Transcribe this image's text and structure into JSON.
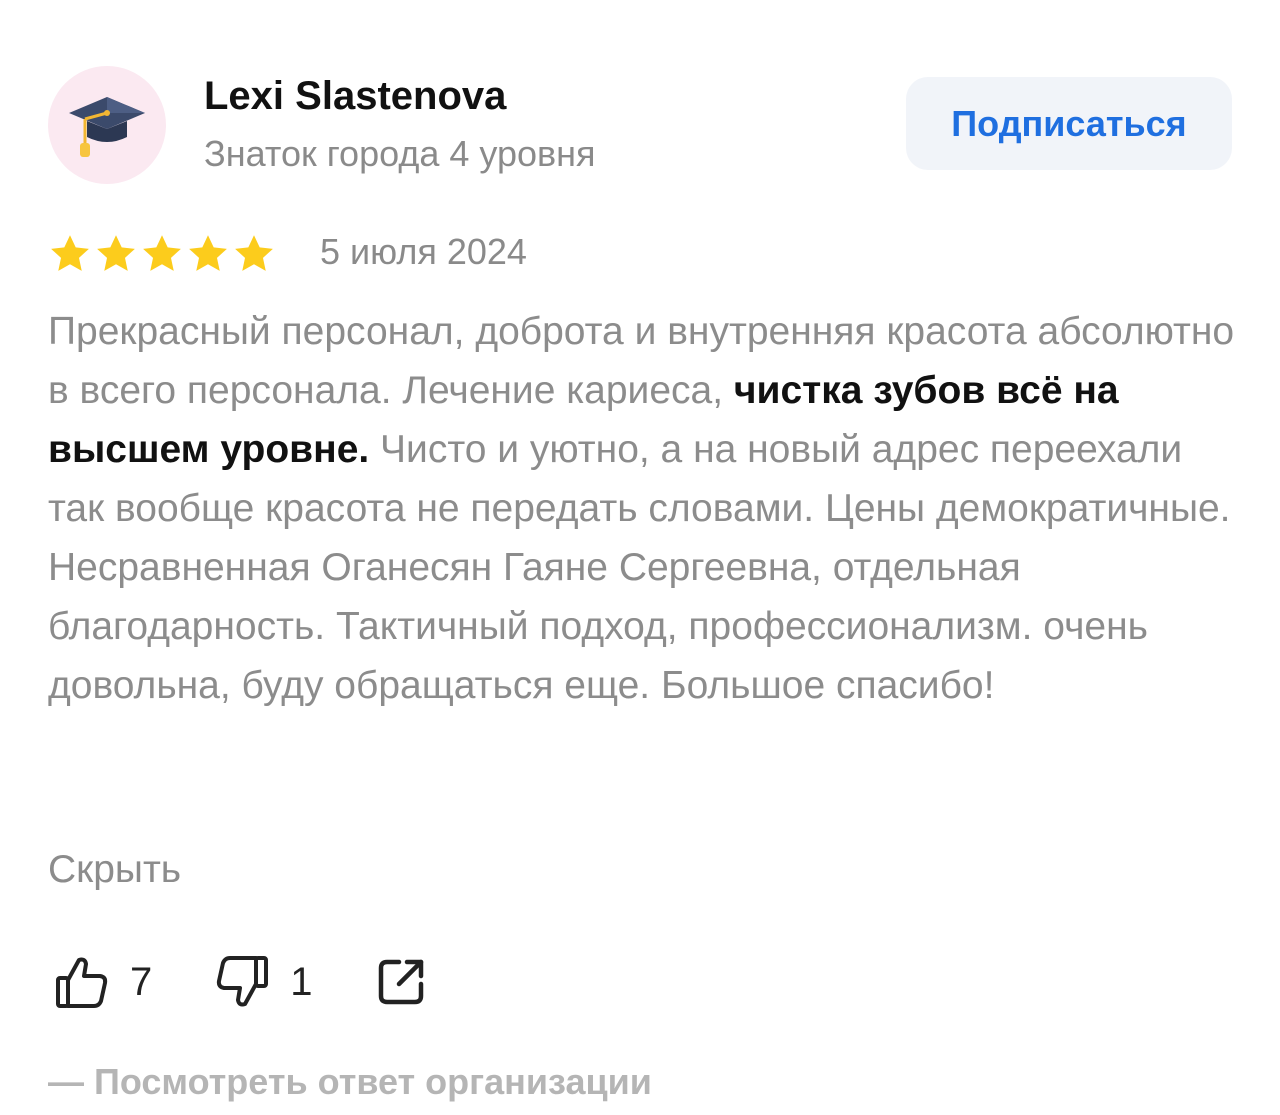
{
  "author": {
    "name": "Lexi Slastenova",
    "level": "Знаток города 4 уровня",
    "avatar_icon": "graduation-cap-icon"
  },
  "subscribe_label": "Подписаться",
  "review": {
    "rating": 5,
    "rating_max": 5,
    "date": "5 июля 2024",
    "text_part1": "Прекрасный персонал, доброта и внутренняя красота абсолютно в всего персонала. Лечение кариеса, ",
    "text_bold": "чистка зубов всё на высшем уровне.",
    "text_part2": " Чисто и уютно, а на новый адрес переехали так вообще красота не передать словами. Цены демократичные. Несравненная Оганесян Гаяне Сергеевна, отдельная благодарность. Тактичный подход, профессионализм. очень довольна, буду обращаться еще. Большое спасибо!",
    "hide_label": "Скрыть"
  },
  "actions": {
    "likes": "7",
    "dislikes": "1",
    "like_icon": "thumbs-up-icon",
    "dislike_icon": "thumbs-down-icon",
    "share_icon": "share-icon"
  },
  "view_answer_label": "— Посмотреть ответ организации",
  "colors": {
    "accent": "#1f6fe0",
    "star": "#fccc1c",
    "muted_text": "#8c8c8c",
    "button_bg": "#f1f4f9",
    "avatar_bg": "#fbe9f1"
  }
}
